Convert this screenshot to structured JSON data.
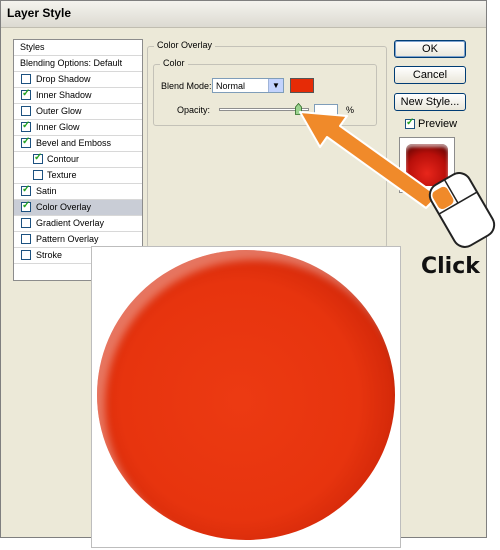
{
  "window": {
    "title": "Layer Style"
  },
  "sidebar": {
    "header": "Styles",
    "items": [
      {
        "label": "Blending Options: Default",
        "checkbox": false
      },
      {
        "label": "Drop Shadow",
        "checkbox": true,
        "checked": false
      },
      {
        "label": "Inner Shadow",
        "checkbox": true,
        "checked": true
      },
      {
        "label": "Outer Glow",
        "checkbox": true,
        "checked": false
      },
      {
        "label": "Inner Glow",
        "checkbox": true,
        "checked": true
      },
      {
        "label": "Bevel and Emboss",
        "checkbox": true,
        "checked": true
      },
      {
        "label": "Contour",
        "checkbox": true,
        "checked": true
      },
      {
        "label": "Texture",
        "checkbox": true,
        "checked": false
      },
      {
        "label": "Satin",
        "checkbox": true,
        "checked": true
      },
      {
        "label": "Color Overlay",
        "checkbox": true,
        "checked": true,
        "selected": true
      },
      {
        "label": "Gradient Overlay",
        "checkbox": true,
        "checked": false
      },
      {
        "label": "Pattern Overlay",
        "checkbox": true,
        "checked": false
      },
      {
        "label": "Stroke",
        "checkbox": true,
        "checked": false
      }
    ]
  },
  "panel": {
    "group_title": "Color Overlay",
    "subgroup_title": "Color",
    "blend_mode_label": "Blend Mode:",
    "blend_mode_value": "Normal",
    "overlay_color": "#e62b06",
    "opacity_label": "Opacity:",
    "opacity_value": "",
    "opacity_unit": "%",
    "opacity_level": 0.88
  },
  "buttons": {
    "ok": "OK",
    "cancel": "Cancel",
    "new_style": "New Style...",
    "preview_label": "Preview",
    "preview_checked": true
  },
  "annotation": {
    "click_label": "Click",
    "arrow_color": "#f08a2a"
  },
  "icons": [
    "checkmark-icon",
    "dropdown-arrow-icon",
    "slider-thumb-icon",
    "mouse-icon",
    "arrow-icon"
  ]
}
